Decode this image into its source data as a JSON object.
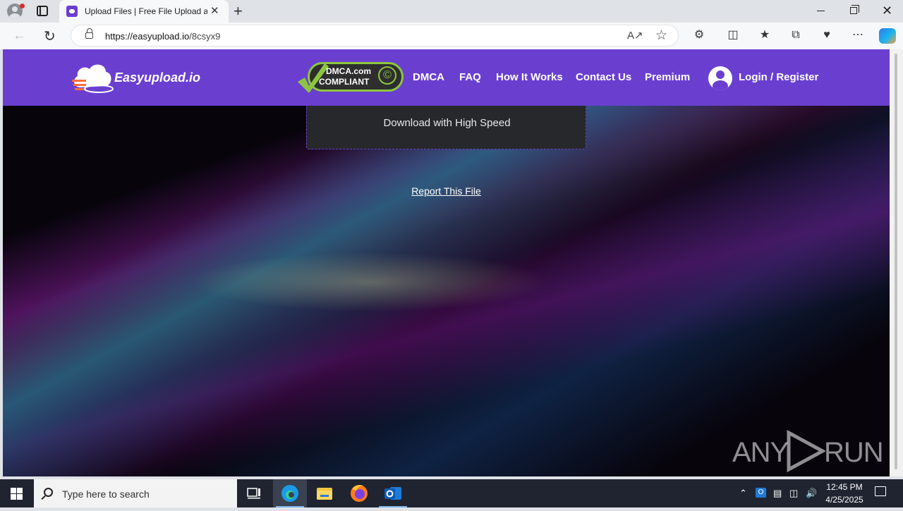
{
  "browser": {
    "tab_title": "Upload Files | Free File Upload and Sharing",
    "tab_close": "✕",
    "new_tab": "+",
    "url_host": "https://easyupload.io",
    "url_path": "/8csyx9",
    "window_close": "✕"
  },
  "site": {
    "logo_text": "Easyupload.io",
    "dmca_line1": "DMCA.com",
    "dmca_line2": "COMPLIANT",
    "dmca_symbol": "©",
    "nav": {
      "dmca": "DMCA",
      "faq": "FAQ",
      "how_it_works": "How It Works",
      "contact": "Contact Us",
      "premium": "Premium",
      "login": "Login / Register"
    },
    "brand_color": "#6a3fd0"
  },
  "main": {
    "download_button": "Download with High Speed",
    "report_link": "Report This File"
  },
  "watermark": {
    "left": "ANY",
    "right": "RUN"
  },
  "taskbar": {
    "search_placeholder": "Type here to search",
    "time": "12:45 PM",
    "date": "4/25/2025",
    "apps": [
      "task-view",
      "edge",
      "file-explorer",
      "firefox",
      "outlook"
    ]
  }
}
